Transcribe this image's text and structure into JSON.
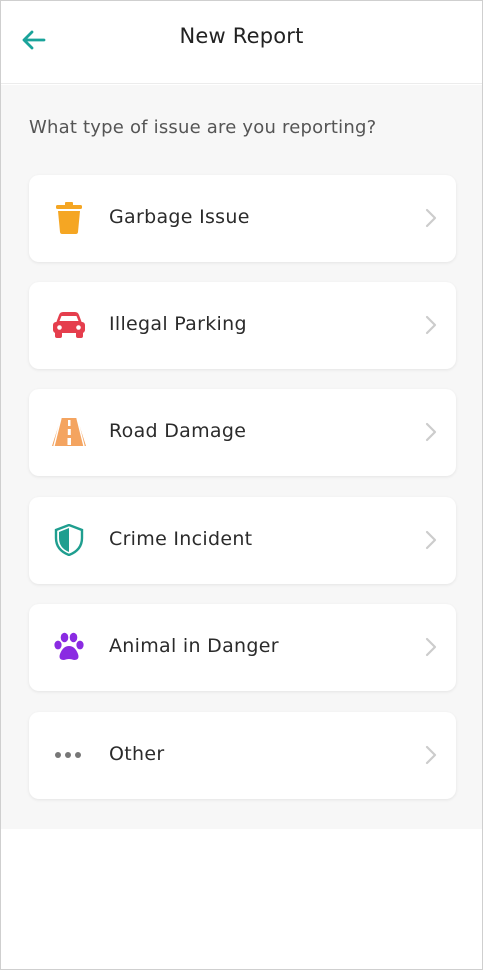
{
  "header": {
    "title": "New Report",
    "back_icon": "arrow-left-icon",
    "accent": "#1aa39a"
  },
  "prompt": "What type of issue are you reporting?",
  "options": [
    {
      "label": "Garbage Issue",
      "icon": "trash-can-icon",
      "color": "#f5a623"
    },
    {
      "label": "Illegal Parking",
      "icon": "car-icon",
      "color": "#e53e4d"
    },
    {
      "label": "Road Damage",
      "icon": "road-icon",
      "color": "#f4a460"
    },
    {
      "label": "Crime Incident",
      "icon": "shield-icon",
      "color": "#1f9e8f"
    },
    {
      "label": "Animal in Danger",
      "icon": "paw-icon",
      "color": "#8a2be2"
    },
    {
      "label": "Other",
      "icon": "ellipsis-icon",
      "color": "#777777"
    }
  ]
}
